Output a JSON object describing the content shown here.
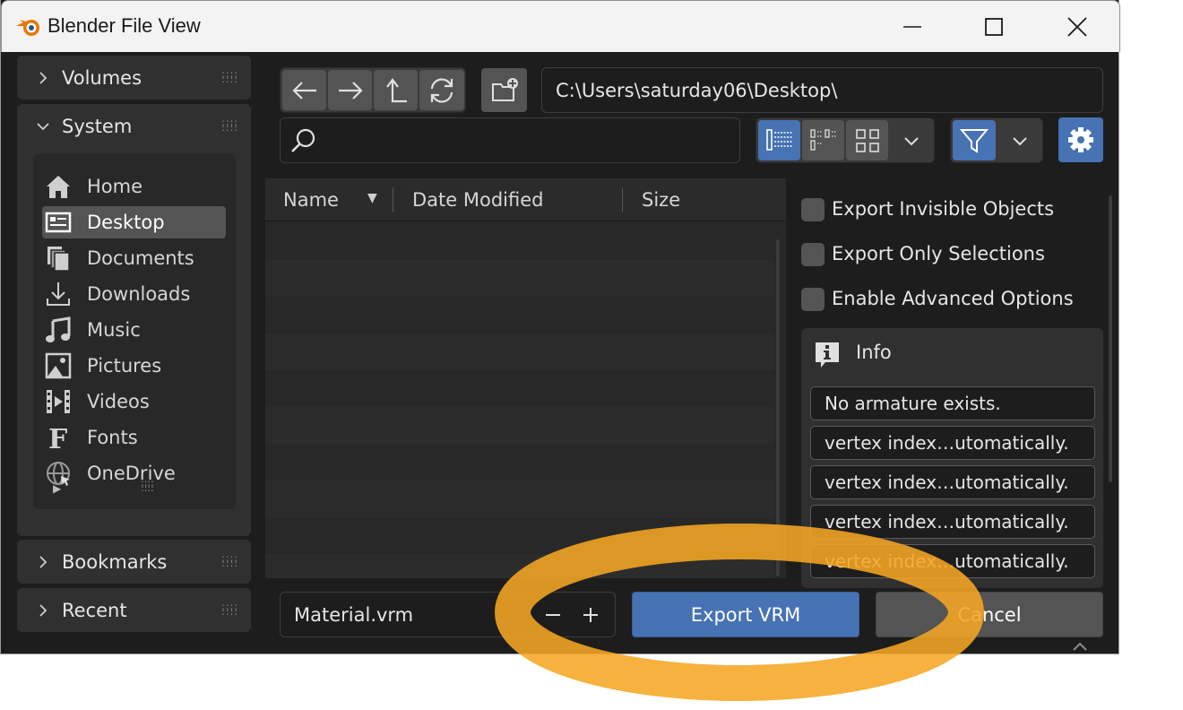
{
  "window": {
    "title": "Blender File View"
  },
  "sidebar": {
    "volumes_label": "Volumes",
    "system_label": "System",
    "places": [
      {
        "label": "Home",
        "icon": "home-icon"
      },
      {
        "label": "Desktop",
        "icon": "desktop-icon",
        "active": true
      },
      {
        "label": "Documents",
        "icon": "documents-icon"
      },
      {
        "label": "Downloads",
        "icon": "downloads-icon"
      },
      {
        "label": "Music",
        "icon": "music-icon"
      },
      {
        "label": "Pictures",
        "icon": "pictures-icon"
      },
      {
        "label": "Videos",
        "icon": "videos-icon"
      },
      {
        "label": "Fonts",
        "icon": "fonts-icon"
      },
      {
        "label": "OneDrive",
        "icon": "onedrive-icon"
      }
    ],
    "bookmarks_label": "Bookmarks",
    "recent_label": "Recent"
  },
  "toolbar": {
    "path": "C:\\Users\\saturday06\\Desktop\\",
    "search_placeholder": ""
  },
  "filelist": {
    "columns": [
      "Name",
      "Date Modified",
      "Size"
    ]
  },
  "options": {
    "export_invisible": "Export Invisible Objects",
    "export_only_selections": "Export Only Selections",
    "enable_advanced": "Enable Advanced Options",
    "info_title": "Info",
    "messages": [
      "No armature exists.",
      "vertex index…utomatically.",
      "vertex index…utomatically.",
      "vertex index…utomatically.",
      "vertex index…utomatically."
    ]
  },
  "footer": {
    "filename": "Material.vrm",
    "export_button": "Export VRM",
    "cancel_button": "Cancel"
  },
  "colors": {
    "accent": "#4772b3",
    "highlight": "#f5a623"
  }
}
